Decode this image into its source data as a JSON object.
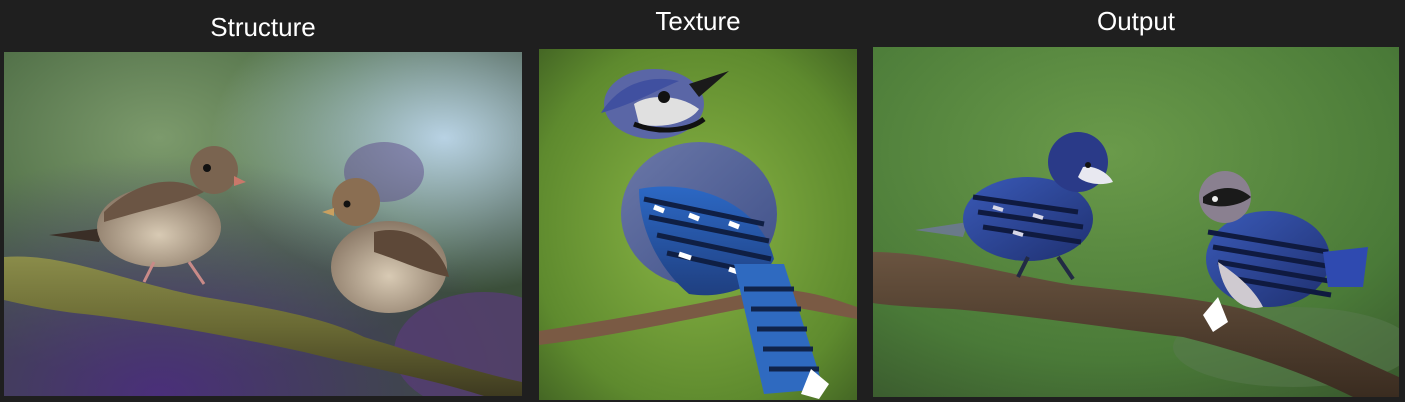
{
  "panels": [
    {
      "label": "Structure",
      "image": "sparrows-on-branch-photo"
    },
    {
      "label": "Texture",
      "image": "blue-jay-on-branch-photo"
    },
    {
      "label": "Output",
      "image": "blue-jay-textured-sparrows-photo"
    }
  ]
}
